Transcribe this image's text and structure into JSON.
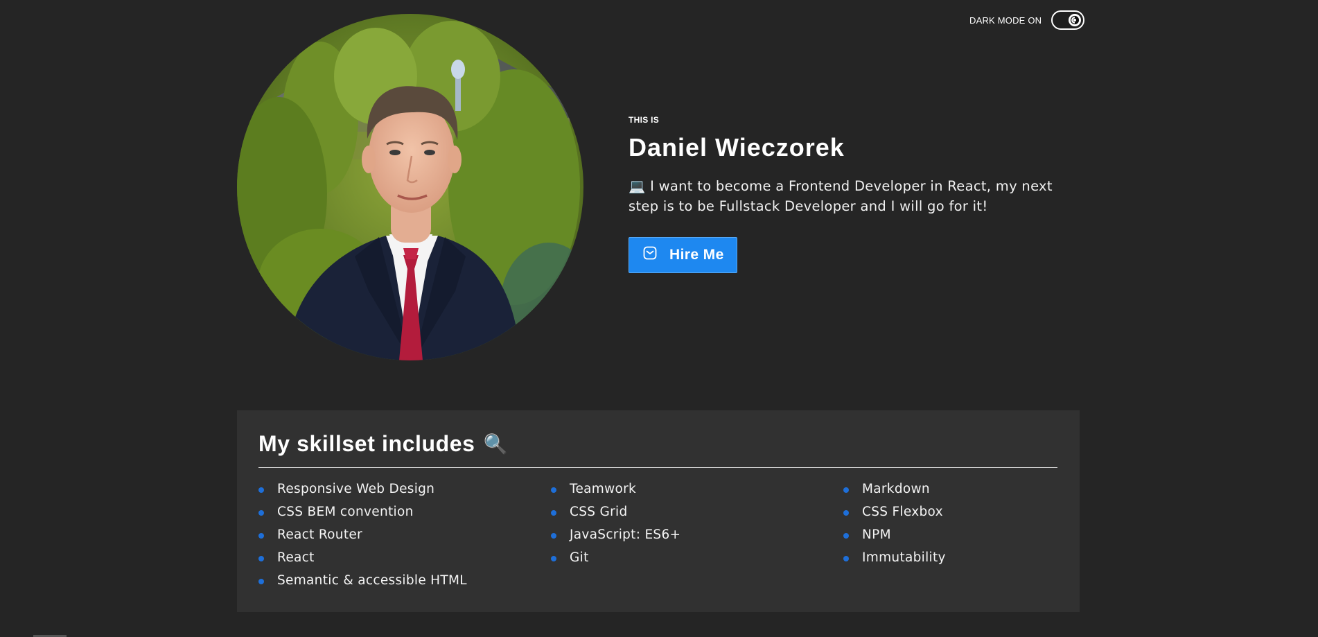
{
  "theme_toggle": {
    "label": "DARK MODE ON",
    "state": "on",
    "icon": "brightness-icon"
  },
  "hero": {
    "kicker": "THIS IS",
    "name": "Daniel Wieczorek",
    "description_emoji": "💻",
    "description": "I want to become a Frontend Developer in React, my next step is to be Fullstack Developer and I will go for it!",
    "hire_button": {
      "label": "Hire Me",
      "icon": "mail-icon"
    },
    "photo_alt": "Daniel Wieczorek portrait"
  },
  "skills": {
    "title": "My skillset includes",
    "title_emoji": "🔍",
    "items": [
      "Responsive Web Design",
      "CSS BEM convention",
      "React Router",
      "React",
      "Semantic & accessible HTML",
      "Teamwork",
      "CSS Grid",
      "JavaScript: ES6+",
      "Git",
      "Markdown",
      "CSS Flexbox",
      "NPM",
      "Immutability"
    ],
    "column_lengths": [
      5,
      4,
      4
    ]
  },
  "colors": {
    "background": "#252525",
    "section_background": "#313131",
    "accent": "#1e88f0",
    "bullet": "#1e6fd9",
    "text": "#ffffff"
  }
}
